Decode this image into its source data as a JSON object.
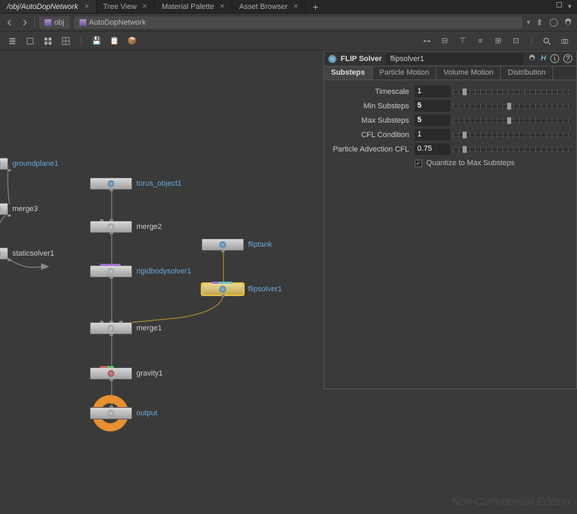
{
  "title_tabs": [
    {
      "label": "/obj/AutoDopNetwork",
      "active": true
    },
    {
      "label": "Tree View",
      "active": false
    },
    {
      "label": "Material Palette",
      "active": false
    },
    {
      "label": "Asset Browser",
      "active": false
    }
  ],
  "path": {
    "segment1": "obj",
    "segment2": "AutoDopNetwork"
  },
  "nodes": {
    "groundplane": "groundplane1",
    "merge3": "merge3",
    "staticsolver": "staticsolver1",
    "torus": "torus_object1",
    "merge2": "merge2",
    "rigidbody": "rigidbodysolver1",
    "fliptank": "fliptank",
    "flipsolver": "flipsolver1",
    "merge1": "merge1",
    "gravity": "gravity1",
    "output": "output"
  },
  "param_panel": {
    "node_type": "FLIP Solver",
    "node_name": "flipsolver1",
    "tabs": [
      "Substeps",
      "Particle Motion",
      "Volume Motion",
      "Distribution"
    ],
    "active_tab": 0,
    "params": {
      "timescale": {
        "label": "Timescale",
        "value": "1",
        "handle": 8
      },
      "min_substeps": {
        "label": "Min Substeps",
        "value": "5",
        "handle": 46,
        "bold": true
      },
      "max_substeps": {
        "label": "Max Substeps",
        "value": "5",
        "handle": 46,
        "bold": true
      },
      "cfl": {
        "label": "CFL Condition",
        "value": "1",
        "handle": 8
      },
      "advection_cfl": {
        "label": "Particle Advection CFL",
        "value": "0.75",
        "handle": 8
      }
    },
    "checkbox": {
      "label": "Quantize to Max Substeps",
      "checked": true
    }
  },
  "watermark": "Non-Commercial Edition"
}
